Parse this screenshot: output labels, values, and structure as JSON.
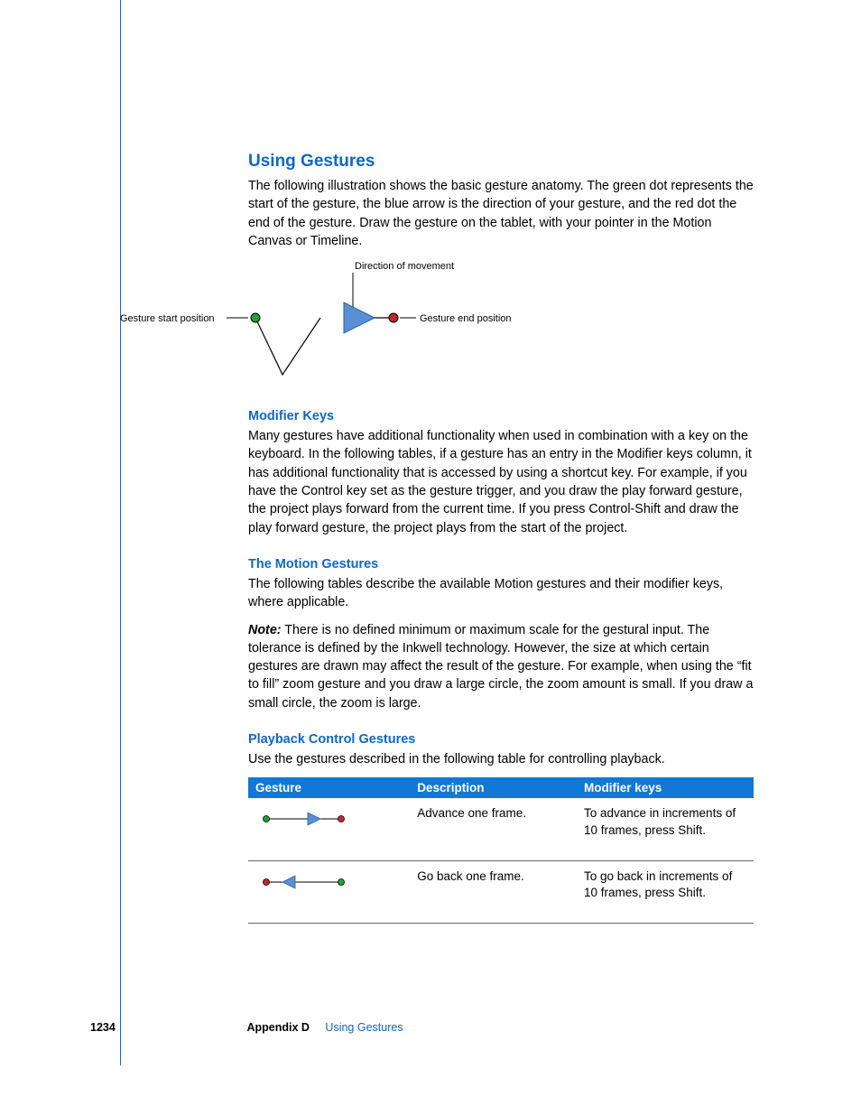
{
  "title": "Using Gestures",
  "intro": "The following illustration shows the basic gesture anatomy. The green dot represents the start of the gesture, the blue arrow is the direction of your gesture, and the red dot the end of the gesture. Draw the gesture on the tablet, with your pointer in the Motion Canvas or Timeline.",
  "diagram": {
    "dir_label": "Direction of movement",
    "start_label": "Gesture start position",
    "end_label": "Gesture end position"
  },
  "sections": {
    "modkeys": {
      "heading": "Modifier Keys",
      "body": "Many gestures have additional functionality when used in combination with a key on the keyboard. In the following tables, if a gesture has an entry in the Modifier keys column, it has additional functionality that is accessed by using a shortcut key. For example, if you have the Control key set as the gesture trigger, and you draw the play forward gesture, the project plays forward from the current time. If you press Control-Shift and draw the play forward gesture, the project plays from the start of the project."
    },
    "motion": {
      "heading": "The Motion Gestures",
      "body": "The following tables describe the available Motion gestures and their modifier keys, where applicable.",
      "note_lead": "Note:",
      "note_body": "There is no defined minimum or maximum scale for the gestural input. The tolerance is defined by the Inkwell technology. However, the size at which certain gestures are drawn may affect the result of the gesture. For example, when using the “fit to fill” zoom gesture and you draw a large circle, the zoom amount is small. If you draw a small circle, the zoom is large."
    },
    "playback": {
      "heading": "Playback Control Gestures",
      "body": "Use the gestures described in the following table for controlling playback."
    }
  },
  "table": {
    "headers": {
      "c1": "Gesture",
      "c2": "Description",
      "c3": "Modifier keys"
    },
    "rows": [
      {
        "desc": "Advance one frame.",
        "mod": "To advance in increments of 10 frames, press Shift."
      },
      {
        "desc": "Go back one frame.",
        "mod": "To go back in increments of 10 frames, press Shift."
      }
    ]
  },
  "footer": {
    "page": "1234",
    "appendix": "Appendix D",
    "title": "Using Gestures"
  }
}
